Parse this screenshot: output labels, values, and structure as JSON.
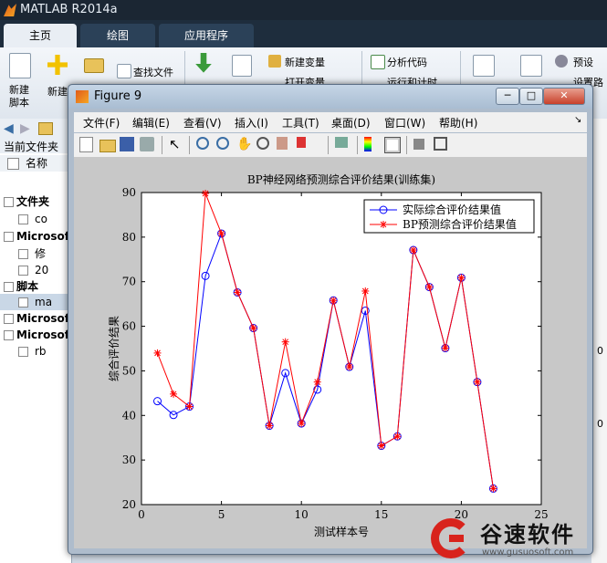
{
  "app": {
    "title": "MATLAB R2014a"
  },
  "tabs": [
    "主页",
    "绘图",
    "应用程序"
  ],
  "ribbon": {
    "new_script": "新建\n脚本",
    "new": "新建",
    "find_files": "查找文件",
    "new_variable": "新建变量",
    "open_variable": "打开变量",
    "analyze_code": "分析代码",
    "run_and_time": "运行和计时",
    "preferences": "预设",
    "set_path": "设置路径"
  },
  "left_panel": {
    "current_folder": "当前文件夹",
    "name_col": "名称",
    "rows": [
      {
        "label": "文件夹",
        "type": "head"
      },
      {
        "label": "co",
        "type": "item"
      },
      {
        "label": "Microsof",
        "type": "head"
      },
      {
        "label": "修",
        "type": "item"
      },
      {
        "label": "20",
        "type": "item"
      },
      {
        "label": "脚本",
        "type": "head"
      },
      {
        "label": "ma",
        "type": "item"
      },
      {
        "label": "Microsof",
        "type": "head"
      },
      {
        "label": "Microsof",
        "type": "head"
      },
      {
        "label": "rb",
        "type": "item"
      }
    ]
  },
  "figure": {
    "title": "Figure 9",
    "menu": [
      "文件(F)",
      "编辑(E)",
      "查看(V)",
      "插入(I)",
      "工具(T)",
      "桌面(D)",
      "窗口(W)",
      "帮助(H)"
    ]
  },
  "chart_data": {
    "type": "line",
    "title": "BP神经网络预测综合评价结果(训练集)",
    "xlabel": "测试样本号",
    "ylabel": "综合评价结果",
    "xlim": [
      0,
      25
    ],
    "ylim": [
      20,
      90
    ],
    "xticks": [
      0,
      5,
      10,
      15,
      20,
      25
    ],
    "yticks": [
      20,
      30,
      40,
      50,
      60,
      70,
      80,
      90
    ],
    "legend_position": "top-right",
    "x": [
      1,
      2,
      3,
      4,
      5,
      6,
      7,
      8,
      9,
      10,
      11,
      12,
      13,
      14,
      15,
      16,
      17,
      18,
      19,
      20,
      21,
      22
    ],
    "series": [
      {
        "name": "实际综合评价结果值",
        "color": "#0000ff",
        "marker": "circle",
        "values": [
          43.2,
          40.1,
          42.0,
          71.3,
          80.8,
          67.6,
          59.6,
          37.7,
          49.5,
          38.2,
          45.8,
          65.8,
          50.9,
          63.5,
          33.2,
          35.3,
          77.1,
          68.8,
          55.1,
          70.9,
          47.5,
          23.6
        ]
      },
      {
        "name": "BP预测综合评价结果值",
        "color": "#ff0000",
        "marker": "star",
        "values": [
          54.0,
          44.8,
          42.0,
          89.8,
          80.8,
          67.6,
          59.6,
          37.7,
          56.5,
          38.2,
          47.5,
          65.8,
          50.9,
          67.9,
          33.2,
          35.3,
          77.1,
          68.8,
          55.1,
          70.9,
          47.5,
          23.6
        ]
      }
    ]
  },
  "watermark": {
    "text": "谷速软件",
    "url": "www.gusuosoft.com"
  },
  "right_edge": {
    "values": [
      "0",
      "0"
    ]
  }
}
